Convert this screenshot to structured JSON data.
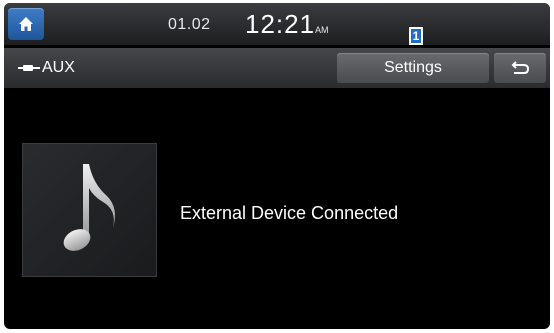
{
  "status_bar": {
    "date": "01.02",
    "time": "12:21",
    "am_pm": "AM",
    "home_icon": "home-icon"
  },
  "marker": {
    "label": "1"
  },
  "source": {
    "icon": "aux-cable-icon",
    "label": "AUX"
  },
  "toolbar": {
    "settings_label": "Settings",
    "back_icon": "back-arrow-icon"
  },
  "main": {
    "album_art_icon": "music-note-icon",
    "status_text": "External Device Connected"
  },
  "colors": {
    "home_button": "#2a6ab4",
    "background": "#000000",
    "marker_badge": "#1e6fc4"
  }
}
